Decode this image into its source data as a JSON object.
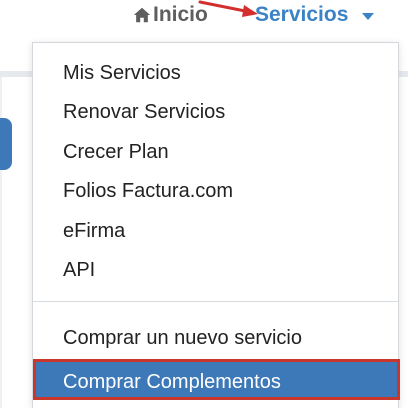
{
  "nav": {
    "home_label": "Inicio",
    "home_icon": "home-icon",
    "services_label": "Servicios",
    "services_icon": "caret-down-icon"
  },
  "dropdown": {
    "items": [
      {
        "label": "Mis Servicios"
      },
      {
        "label": "Renovar Servicios"
      },
      {
        "label": "Crecer Plan"
      },
      {
        "label": "Folios Factura.com"
      },
      {
        "label": "eFirma"
      },
      {
        "label": "API"
      }
    ],
    "secondary_items": [
      {
        "label": "Comprar un nuevo servicio"
      },
      {
        "label": "Comprar Complementos",
        "highlighted": true
      }
    ]
  },
  "colors": {
    "accent": "#3b83c4",
    "highlight_bg": "#3d79b8",
    "highlight_border": "#c9362b",
    "annotation_arrow": "#d32f2f"
  }
}
